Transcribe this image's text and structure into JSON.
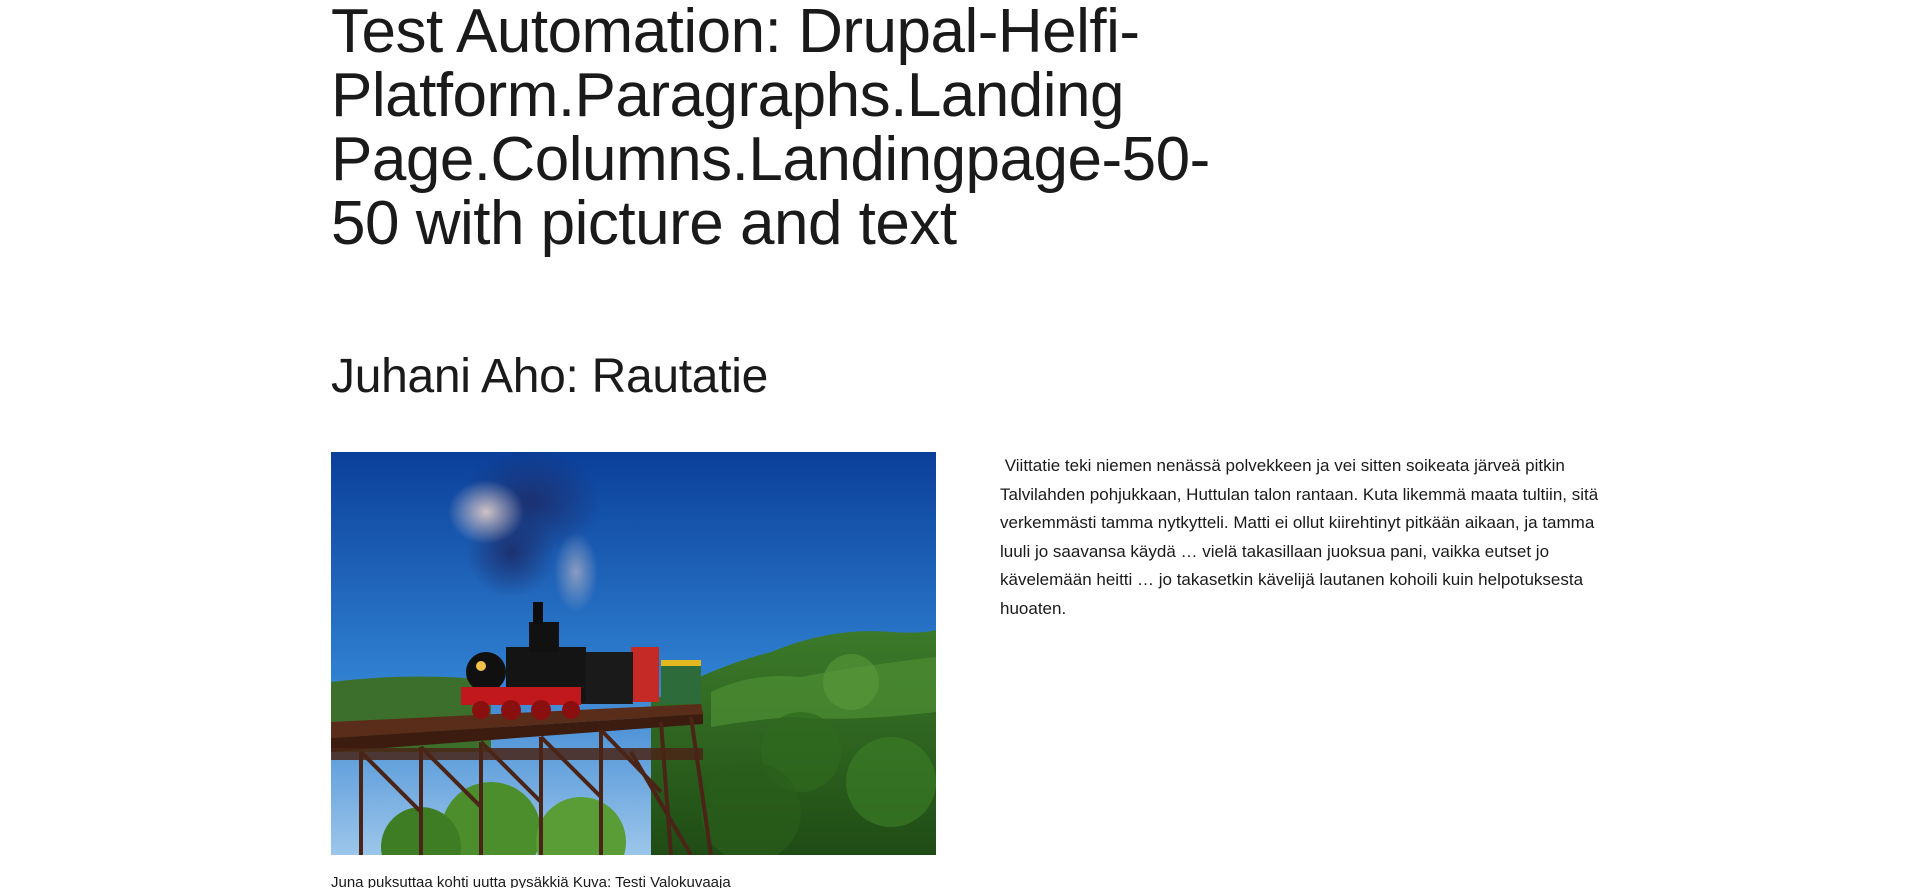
{
  "page": {
    "title": "Test Automation: Drupal-Helfi-Platform.Paragraphs.Landing Page.Columns.Landingpage-50-50 with picture and text"
  },
  "section": {
    "title": "Juhani Aho: Rautatie"
  },
  "left_column": {
    "image_alt": "Steam locomotive crossing a trestle bridge",
    "caption": "Juna puksuttaa kohti uutta pysäkkiä Kuva: Testi Valokuvaaja"
  },
  "right_column": {
    "paragraph": " Viittatie teki niemen nenässä polvekkeen ja vei sitten soikeata järveä pitkin Talvilahden pohjukkaan, Huttulan talon rantaan. Kuta likemmä maata tultiin, sitä verkemmästi tamma nytkytteli. Matti ei ollut kiirehtinyt pitkään aikaan, ja tamma luuli jo saavansa käydä … vielä takasillaan juoksua pani, vaikka eutset jo kävelemään heitti … jo takasetkin kävelijä lautanen kohoili kuin helpotuksesta huoaten."
  }
}
